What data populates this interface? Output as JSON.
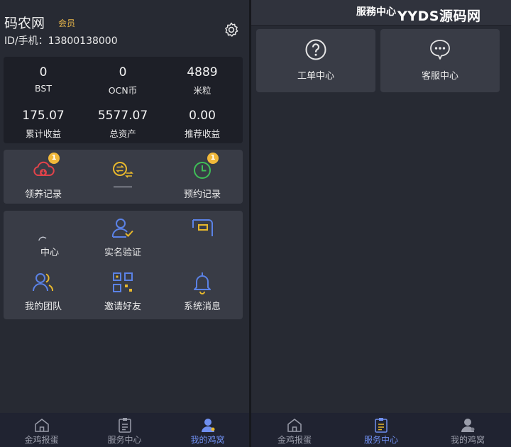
{
  "profile": {
    "name": "码农网",
    "badge": "会员",
    "id_line": "ID/手机：13800138000"
  },
  "stats": [
    {
      "value": "0",
      "label": "BST"
    },
    {
      "value": "0",
      "label": "OCN币"
    },
    {
      "value": "4889",
      "label": "米粒"
    },
    {
      "value": "175.07",
      "label": "累计收益"
    },
    {
      "value": "5577.07",
      "label": "总资产"
    },
    {
      "value": "0.00",
      "label": "推荐收益"
    }
  ],
  "records": [
    {
      "label": "领养记录",
      "icon": "cloud-download-icon",
      "badge": "1",
      "color": "#e0434a"
    },
    {
      "label": "",
      "icon": "exchange-icon",
      "badge": "",
      "color": "#e8b82c"
    },
    {
      "label": "预约记录",
      "icon": "clock-icon",
      "badge": "1",
      "color": "#3fbf57"
    }
  ],
  "menu": [
    {
      "label": "中心",
      "icon": "partial-icon"
    },
    {
      "label": "实名验证",
      "icon": "user-verify-icon"
    },
    {
      "label": "",
      "icon": "card-icon"
    },
    {
      "label": "我的团队",
      "icon": "team-icon"
    },
    {
      "label": "邀请好友",
      "icon": "qrcode-icon"
    },
    {
      "label": "系统消息",
      "icon": "bell-icon"
    }
  ],
  "nav": [
    {
      "label": "金鸡报蛋",
      "icon": "home-icon"
    },
    {
      "label": "服务中心",
      "icon": "clipboard-icon"
    },
    {
      "label": "我的鸡窝",
      "icon": "person-icon"
    }
  ],
  "left_active_nav": 2,
  "right_active_nav": 1,
  "service": {
    "title": "服務中心",
    "watermark": "YYDS源码网",
    "tiles": [
      {
        "label": "工单中心",
        "icon": "question-icon"
      },
      {
        "label": "客服中心",
        "icon": "chat-icon"
      }
    ]
  },
  "colors": {
    "accent": "#6f8ff0",
    "badge": "#f1b83a",
    "icon_blue": "#5b82e6"
  }
}
